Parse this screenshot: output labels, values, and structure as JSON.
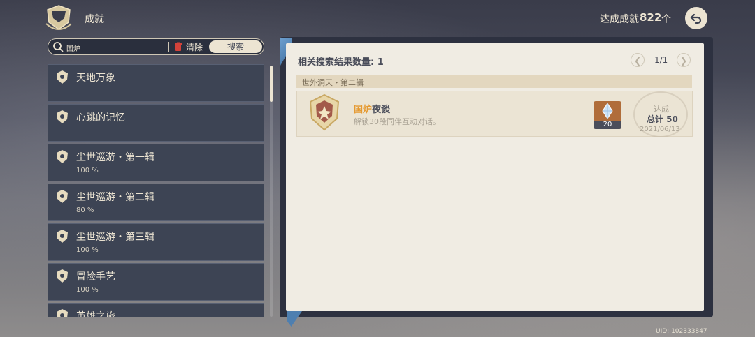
{
  "header": {
    "title": "成就",
    "count_label": "达成成就",
    "count": "822",
    "count_unit": "个"
  },
  "search": {
    "value": "国炉",
    "clear_label": "清除",
    "search_label": "搜索"
  },
  "categories": [
    {
      "name": "天地万象",
      "progress": ""
    },
    {
      "name": "心跳的记忆",
      "progress": ""
    },
    {
      "name": "尘世巡游・第一辑",
      "progress": "100 %"
    },
    {
      "name": "尘世巡游・第二辑",
      "progress": "80 %"
    },
    {
      "name": "尘世巡游・第三辑",
      "progress": "100 %"
    },
    {
      "name": "冒险手艺",
      "progress": "100 %"
    },
    {
      "name": "英雄之旅",
      "progress": ""
    }
  ],
  "results": {
    "count_text": "相关搜索结果数量: 1",
    "page": "1/1",
    "group": "世外洞天・第二辑",
    "achievement": {
      "title_highlight": "国炉",
      "title_rest": "夜谈",
      "desc": "解锁30段同伴互动对话。",
      "reward": "20",
      "status": "达成",
      "total": "总计 50",
      "date": "2021/06/13"
    }
  },
  "uid": "UID: 102333847",
  "colors": {
    "accent": "#e59a32",
    "panel": "#f0ece3",
    "list_item": "#3d4454"
  }
}
